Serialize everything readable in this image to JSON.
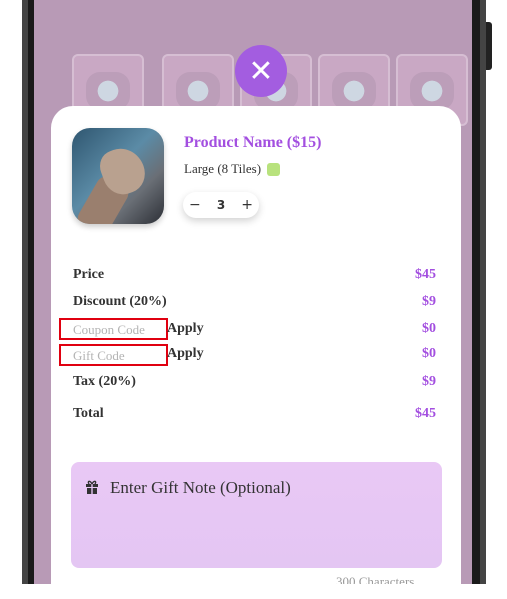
{
  "modal": {
    "close_icon": "close-icon"
  },
  "product": {
    "name": "Product Name ($15)",
    "size": "Large (8 Tiles)",
    "size_swatch_color": "#b8e27d",
    "quantity": "3",
    "decrement": "−",
    "increment": "+"
  },
  "summary": {
    "price_label": "Price",
    "price_value": "$45",
    "discount_label": "Discount (20%)",
    "discount_value": "$9",
    "coupon_placeholder": "Coupon Code",
    "coupon_apply": "Apply",
    "coupon_value": "$0",
    "gift_placeholder": "Gift Code",
    "gift_apply": "Apply",
    "gift_value": "$0",
    "tax_label": "Tax (20%)",
    "tax_value": "$9",
    "total_label": "Total",
    "total_value": "$45"
  },
  "gift_note": {
    "icon": "gift-icon",
    "label": "Enter Gift Note (Optional)",
    "char_limit": "300 Characters"
  },
  "colors": {
    "accent": "#a34fe0",
    "close_button": "#a35de0",
    "highlight_border": "#e00010"
  }
}
